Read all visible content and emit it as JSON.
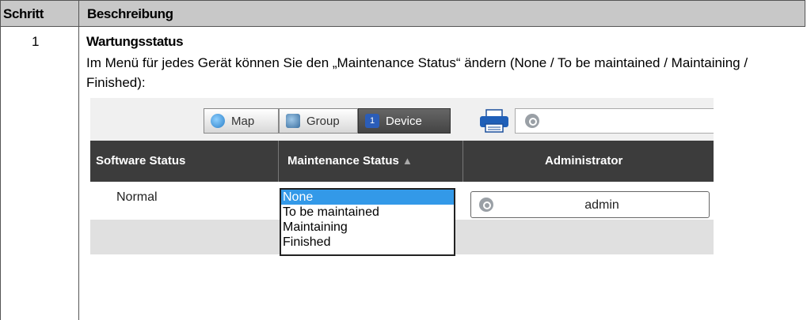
{
  "table": {
    "col1_header": "Schritt",
    "col2_header": "Beschreibung"
  },
  "step": {
    "number": "1",
    "title": "Wartungsstatus",
    "description": "Im Menü für jedes Gerät können Sie den „Maintenance Status“ ändern (None / To be maintained / Maintaining / Finished):"
  },
  "screenshot": {
    "toolbar": {
      "map_label": "Map",
      "group_label": "Group",
      "device_label": "Device",
      "device_icon_text": "1",
      "search_placeholder": ""
    },
    "columns": {
      "software_status": "Software Status",
      "maintenance_status": "Maintenance Status",
      "sort_indicator": "▲",
      "administrator": "Administrator"
    },
    "row": {
      "software_status": "Normal",
      "administrator": "admin"
    },
    "dropdown": {
      "options": [
        "None",
        "To be maintained",
        "Maintaining",
        "Finished"
      ],
      "selected": "None"
    },
    "colors": {
      "header_bg": "#3c3c3c",
      "selected_option": "#3399e8"
    }
  }
}
